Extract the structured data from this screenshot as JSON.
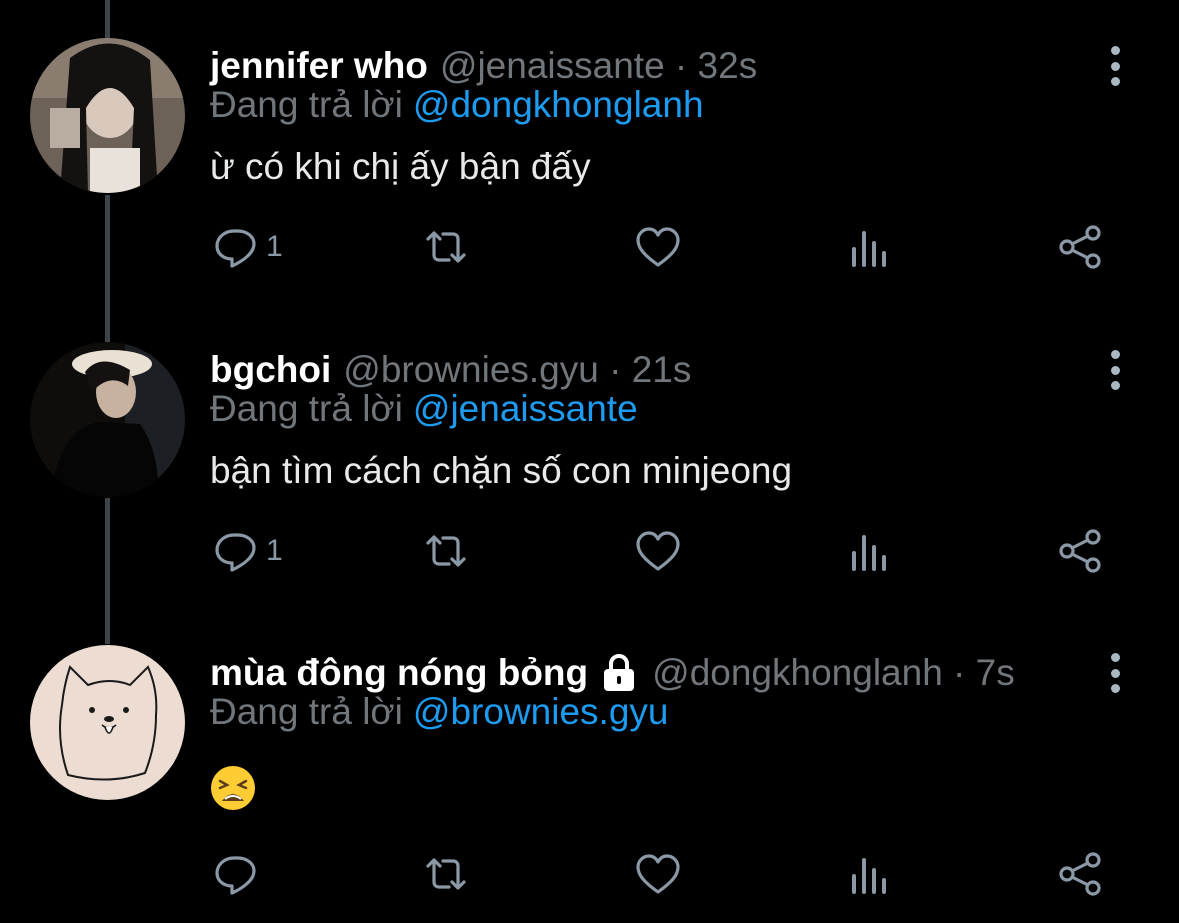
{
  "tweets": [
    {
      "name": "jennifer who",
      "handle": "@jenaissante · 32s",
      "replying_label": "Đang trả lời",
      "replying_to": "@dongkhonglanh",
      "text": "ừ có khi chị ấy bận đấy",
      "reply_count": "1",
      "locked": false
    },
    {
      "name": "bgchoi",
      "handle": "@brownies.gyu · 21s",
      "replying_label": "Đang trả lời",
      "replying_to": "@jenaissante",
      "text": "bận tìm cách chặn số con minjeong",
      "reply_count": "1",
      "locked": false
    },
    {
      "name": "mùa đông nóng bỏng",
      "handle": "@dongkhonglanh · 7s",
      "replying_label": "Đang trả lời",
      "replying_to": "@brownies.gyu",
      "text": "",
      "emoji": "tired-face-emoji",
      "reply_count": "",
      "locked": true
    }
  ],
  "icons": [
    "reply-icon",
    "retweet-icon",
    "like-icon",
    "analytics-icon",
    "share-icon",
    "more-icon",
    "lock-icon"
  ],
  "colors": {
    "background": "#000000",
    "accent": "#1d9bf0",
    "muted": "#71767b",
    "thread_line": "#3d4449"
  }
}
